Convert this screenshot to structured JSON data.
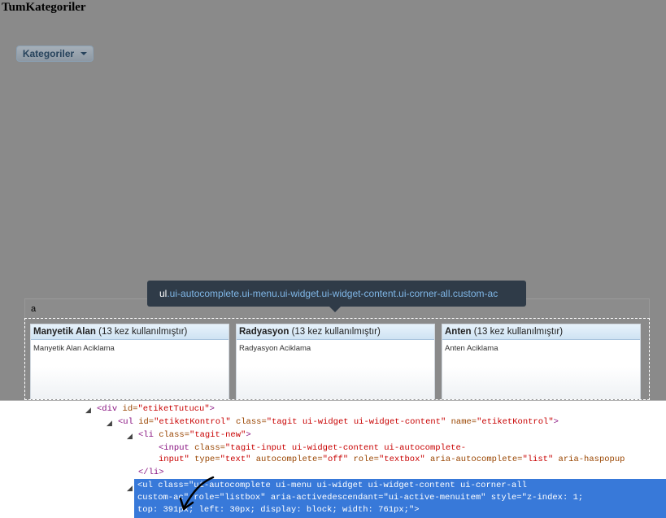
{
  "page": {
    "title": "TumKategoriler"
  },
  "category_button": {
    "label": "Kategoriler"
  },
  "tag_input": {
    "value": "a"
  },
  "tooltip": {
    "tag": "ul",
    "classes": ".ui-autocomplete.ui-menu.ui-widget.ui-widget-content.ui-corner-all.custom-ac"
  },
  "autocomplete": {
    "items": [
      {
        "name": "Manyetik Alan",
        "count": "(13 kez kullanılmıştır)",
        "desc": "Manyetik Alan Aciklama"
      },
      {
        "name": "Radyasyon",
        "count": "(13 kez kullanılmıştır)",
        "desc": "Radyasyon Aciklama"
      },
      {
        "name": "Anten",
        "count": "(13 kez kullanılmıştır)",
        "desc": "Anten Aciklama"
      }
    ]
  },
  "devtools": {
    "line1": {
      "open": "<div",
      "attr": " id=",
      "val": "\"etiketTutucu\"",
      "close": ">"
    },
    "line2": {
      "open": "<ul",
      "a1": " id=",
      "v1": "\"etiketKontrol\"",
      "a2": " class=",
      "v2": "\"tagit ui-widget ui-widget-content\"",
      "a3": " name=",
      "v3": "\"etiketKontrol\"",
      "close": ">"
    },
    "line3": {
      "open": "<li",
      "a1": " class=",
      "v1": "\"tagit-new\"",
      "close": ">"
    },
    "line4": {
      "open": "<input",
      "a1": " class=",
      "v1": "\"tagit-input ui-widget-content ui-autocomplete-"
    },
    "line5": {
      "v1": "input\"",
      "a2": " type=",
      "v2": "\"text\"",
      "a3": " autocomplete=",
      "v3": "\"off\"",
      "a4": " role=",
      "v4": "\"textbox\"",
      "a5": " aria-autocomplete=",
      "v5": "\"list\"",
      "a6": " aria-haspopup"
    },
    "line6": {
      "text": "</li>"
    },
    "sel1": "<ul class=\"ui-autocomplete ui-menu ui-widget ui-widget-content ui-corner-all",
    "sel2": "custom-ac\" role=\"listbox\" aria-activedescendant=\"ui-active-menuitem\" style=\"z-index: 1;",
    "sel3": "top: 391px; left: 30px; display: block; width: 761px;\">"
  }
}
